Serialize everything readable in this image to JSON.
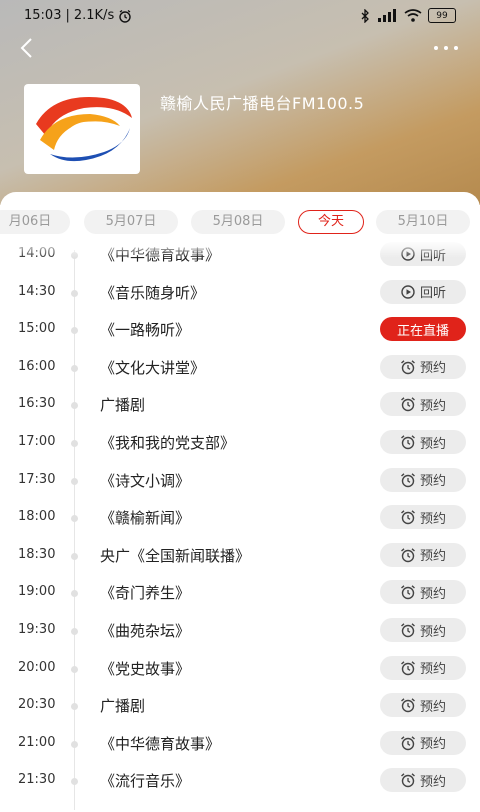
{
  "status": {
    "time": "15:03",
    "speed": "2.1K/s",
    "battery": "99"
  },
  "station": {
    "name": "赣榆人民广播电台FM100.5"
  },
  "dates": [
    "月06日",
    "5月07日",
    "5月08日",
    "今天",
    "5月10日"
  ],
  "actions": {
    "replay": "回听",
    "live": "正在直播",
    "reserve": "预约"
  },
  "programs": [
    {
      "time": "14:00",
      "title": "《中华德育故事》",
      "action": "回听"
    },
    {
      "time": "14:30",
      "title": "《音乐随身听》",
      "action": "回听"
    },
    {
      "time": "15:00",
      "title": "《一路畅听》",
      "action": "正在直播"
    },
    {
      "time": "16:00",
      "title": "《文化大讲堂》",
      "action": "预约"
    },
    {
      "time": "16:30",
      "title": "广播剧",
      "action": "预约"
    },
    {
      "time": "17:00",
      "title": "《我和我的党支部》",
      "action": "预约"
    },
    {
      "time": "17:30",
      "title": "《诗文小调》",
      "action": "预约"
    },
    {
      "time": "18:00",
      "title": "《赣榆新闻》",
      "action": "预约"
    },
    {
      "time": "18:30",
      "title": "央广《全国新闻联播》",
      "action": "预约"
    },
    {
      "time": "19:00",
      "title": "《奇门养生》",
      "action": "预约"
    },
    {
      "time": "19:30",
      "title": "《曲苑杂坛》",
      "action": "预约"
    },
    {
      "time": "20:00",
      "title": "《党史故事》",
      "action": "预约"
    },
    {
      "time": "20:30",
      "title": "广播剧",
      "action": "预约"
    },
    {
      "time": "21:00",
      "title": "《中华德育故事》",
      "action": "预约"
    },
    {
      "time": "21:30",
      "title": "《流行音乐》",
      "action": "预约"
    }
  ],
  "colors": {
    "accent": "#e0231a",
    "chip": "#ececec"
  }
}
